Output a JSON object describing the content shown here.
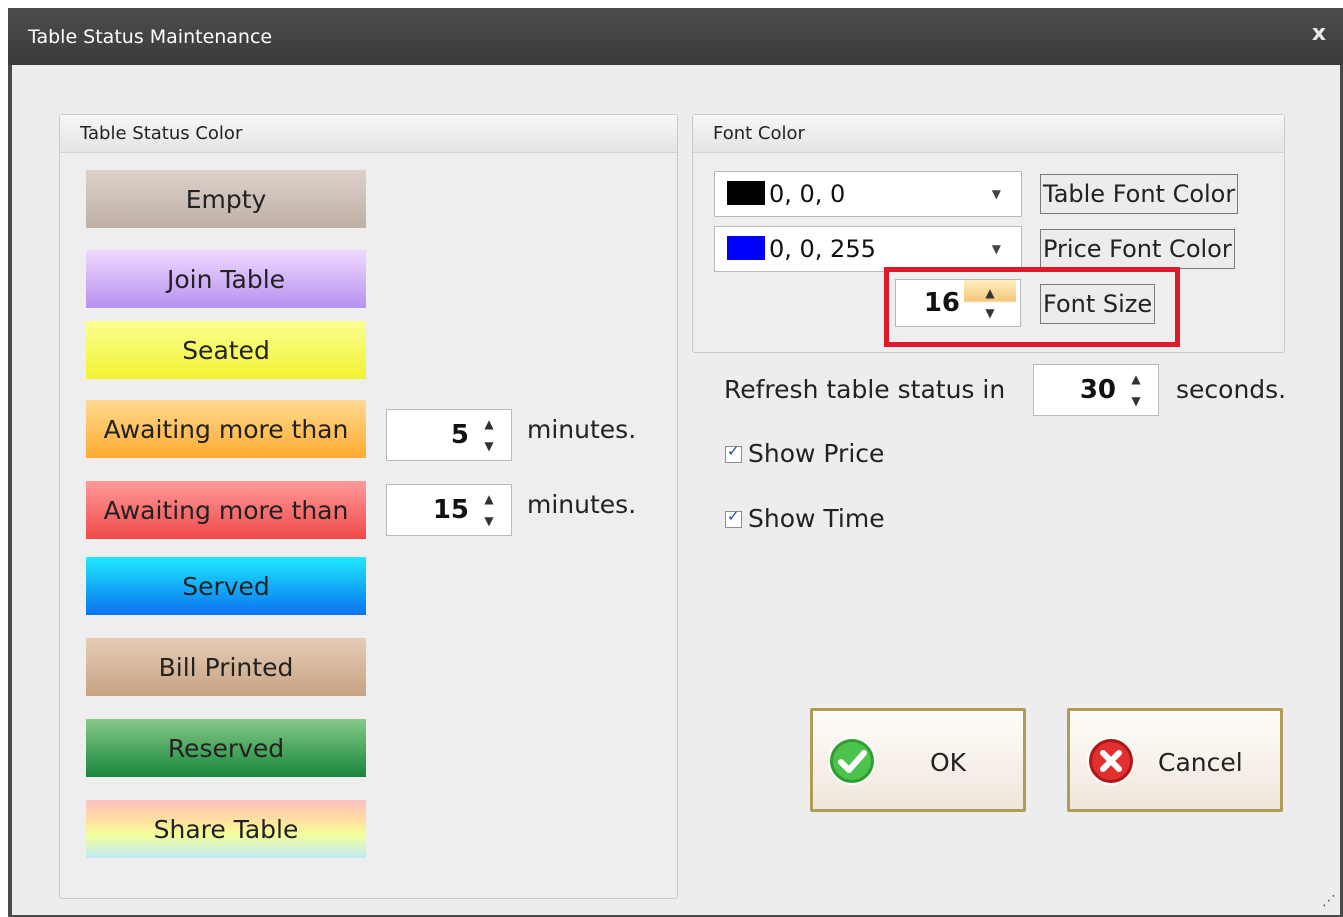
{
  "window": {
    "title": "Table Status Maintenance",
    "close_label": "x"
  },
  "status_group": {
    "header": "Table Status Color",
    "items": [
      {
        "label": "Empty"
      },
      {
        "label": "Join Table"
      },
      {
        "label": "Seated"
      },
      {
        "label": "Awaiting more than",
        "minutes": "5",
        "unit": "minutes."
      },
      {
        "label": "Awaiting more than",
        "minutes": "15",
        "unit": "minutes."
      },
      {
        "label": "Served"
      },
      {
        "label": "Bill Printed"
      },
      {
        "label": "Reserved"
      },
      {
        "label": "Share Table"
      }
    ]
  },
  "font_group": {
    "header": "Font Color",
    "table_font": {
      "value": "0, 0, 0",
      "button": "Table Font Color",
      "swatch_color": "#000000"
    },
    "price_font": {
      "value": "0, 0, 255",
      "button": "Price Font Color",
      "swatch_color": "#0000ff"
    },
    "font_size": {
      "value": "16",
      "button": "Font Size"
    }
  },
  "refresh": {
    "prefix": "Refresh table status in",
    "value": "30",
    "suffix": "seconds."
  },
  "options": {
    "show_price": {
      "label": "Show Price",
      "checked": true
    },
    "show_time": {
      "label": "Show Time",
      "checked": true
    }
  },
  "buttons": {
    "ok": "OK",
    "cancel": "Cancel"
  },
  "colors": {
    "highlight": "#e0182b",
    "accent_border": "#b09b57"
  }
}
